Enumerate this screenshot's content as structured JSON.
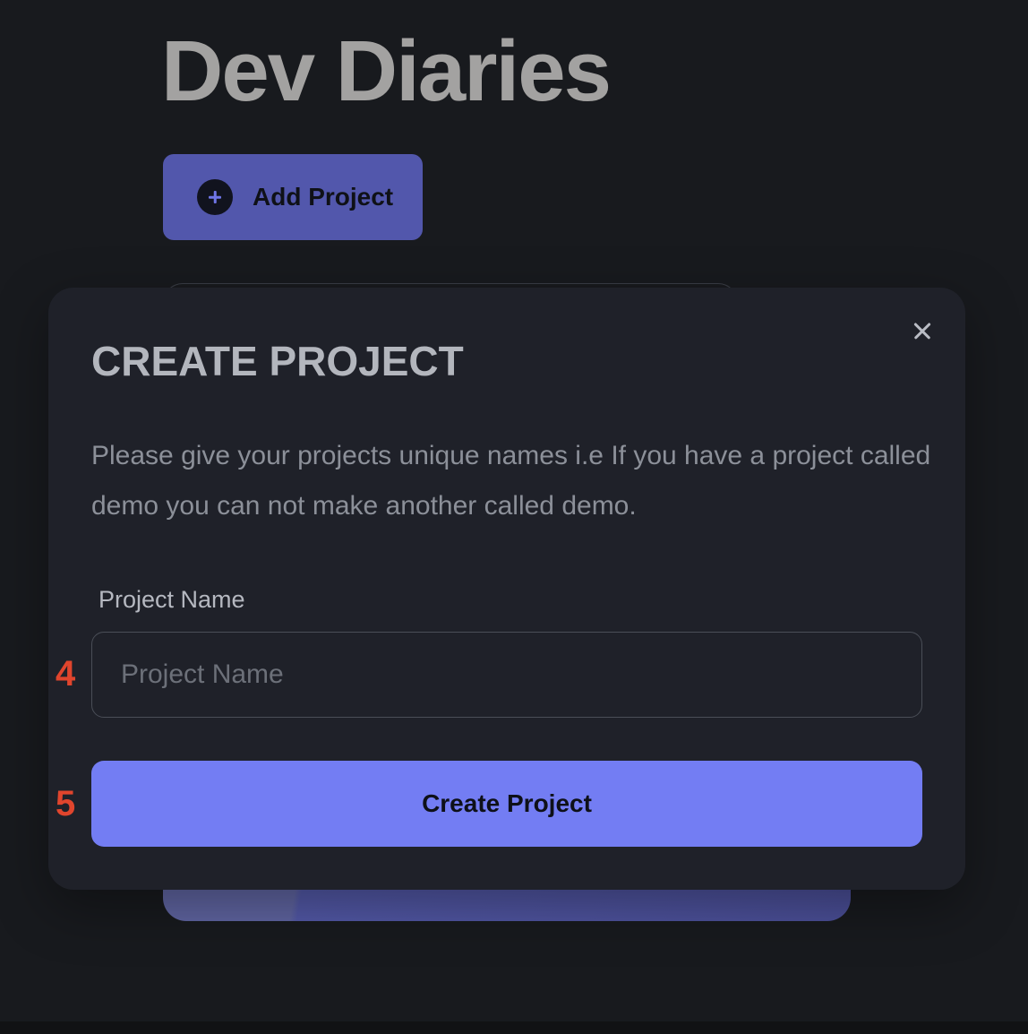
{
  "app": {
    "title": "Dev Diaries",
    "add_project_label": "Add Project"
  },
  "modal": {
    "title": "CREATE PROJECT",
    "description": "Please give your projects unique names i.e If you have a project called demo you can not make another called demo.",
    "field_label": "Project Name",
    "input_value": "",
    "input_placeholder": "Project Name",
    "submit_label": "Create Project"
  },
  "annotations": {
    "input_marker": "4",
    "submit_marker": "5"
  },
  "icons": {
    "add": "plus-circle-icon",
    "close": "close-icon"
  },
  "colors": {
    "background": "#181a1e",
    "modal_bg": "#1f2129",
    "accent": "#737df3",
    "add_button": "#5257ac",
    "marker": "#e0452d"
  }
}
